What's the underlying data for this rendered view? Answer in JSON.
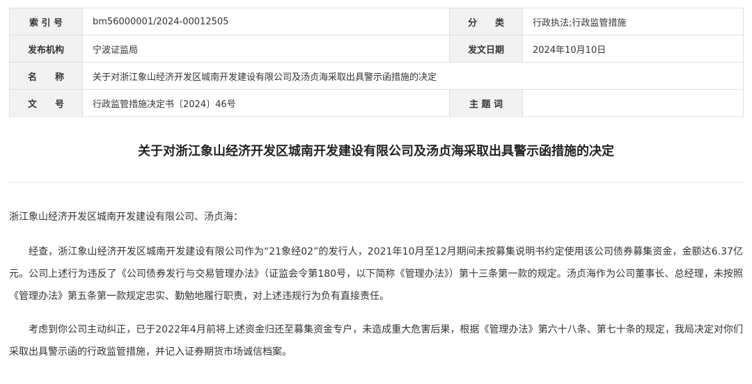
{
  "meta": {
    "index_label": "索 引 号",
    "index_value": "bm56000001/2024-00012505",
    "category_label": "分　　类",
    "category_value": "行政执法;行政监管措施",
    "issuer_label": "发布机构",
    "issuer_value": "宁波证监局",
    "date_label": "发文日期",
    "date_value": "2024年10月10日",
    "name_label": "名　　称",
    "name_value": "关于对浙江象山经济开发区城南开发建设有限公司及汤贞海采取出具警示函措施的决定",
    "docno_label": "文　　号",
    "docno_value": "行政监管措施决定书〔2024〕46号",
    "subject_label": "主 题 词",
    "subject_value": ""
  },
  "article": {
    "title": "关于对浙江象山经济开发区城南开发建设有限公司及汤贞海采取出具警示函措施的决定",
    "salutation": "浙江象山经济开发区城南开发建设有限公司、汤贞海：",
    "paragraph1": "经查，浙江象山经济开发区城南开发建设有限公司作为“21象经02”的发行人，2021年10月至12月期间未按募集说明书约定使用该公司债券募集资金，金额达6.37亿元。公司上述行为违反了《公司债券发行与交易管理办法》（证监会令第180号，以下简称《管理办法》）第十三条第一款的规定。汤贞海作为公司董事长、总经理，未按照《管理办法》第五条第一款规定忠实、勤勉地履行职责，对上述违规行为负有直接责任。",
    "paragraph2": "考虑到你公司主动纠正，已于2022年4月前将上述资金归还至募集资金专户，未造成重大危害后果，根据《管理办法》第六十八条、第七十条的规定，我局决定对你们采取出具警示函的行政监管措施，并记入证券期货市场诚信档案。"
  }
}
